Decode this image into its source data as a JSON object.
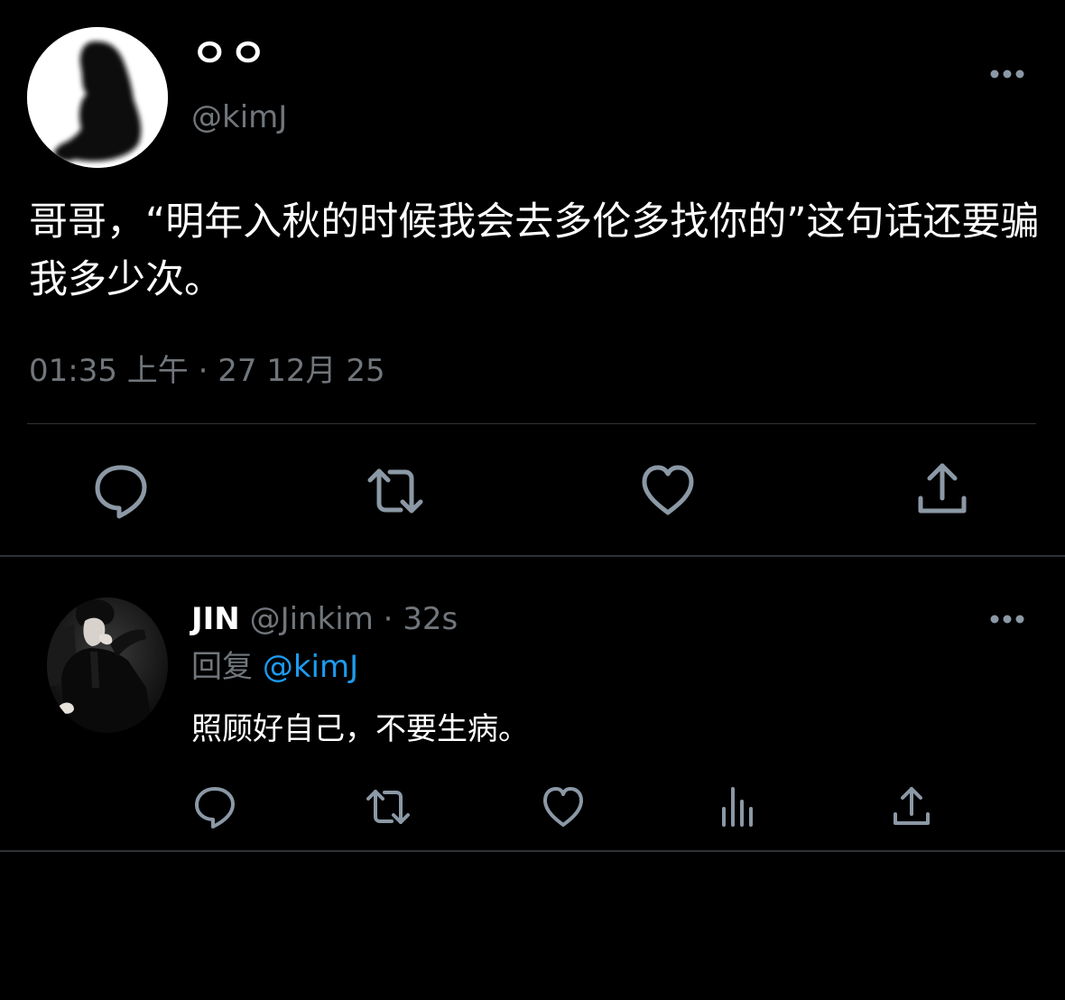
{
  "tweet": {
    "display_name": "ㅇㅇ",
    "handle": "@kimJ",
    "text": "哥哥，“明年入秋的时候我会去多伦多找你的”这句话还要骗我多少次。",
    "meta": "01:35 上午 · 27 12月 25",
    "avatar_icon": "silhouette-avatar",
    "more_icon": "more-horizontal-icon",
    "actions": [
      {
        "name": "reply",
        "icon": "speech-bubble-icon"
      },
      {
        "name": "retweet",
        "icon": "retweet-icon"
      },
      {
        "name": "like",
        "icon": "heart-icon"
      },
      {
        "name": "share",
        "icon": "share-upload-icon"
      }
    ]
  },
  "reply": {
    "display_name": "JIN",
    "handle": "@Jinkim",
    "separator": "·",
    "time": "32s",
    "replying_prefix": "回复",
    "replying_handle": "@kimJ",
    "text": "照顾好自己，不要生病。",
    "avatar_icon": "profile-photo-avatar",
    "more_icon": "more-horizontal-icon",
    "actions": [
      {
        "name": "reply",
        "icon": "speech-bubble-icon"
      },
      {
        "name": "retweet",
        "icon": "retweet-icon"
      },
      {
        "name": "like",
        "icon": "heart-icon"
      },
      {
        "name": "analytics",
        "icon": "bar-chart-icon"
      },
      {
        "name": "share",
        "icon": "share-upload-icon"
      }
    ]
  },
  "colors": {
    "background": "#000000",
    "text_primary": "#ffffff",
    "text_secondary": "#71767b",
    "link": "#1d9bf0",
    "divider": "#2f3336",
    "icon": "#8b98a5"
  }
}
